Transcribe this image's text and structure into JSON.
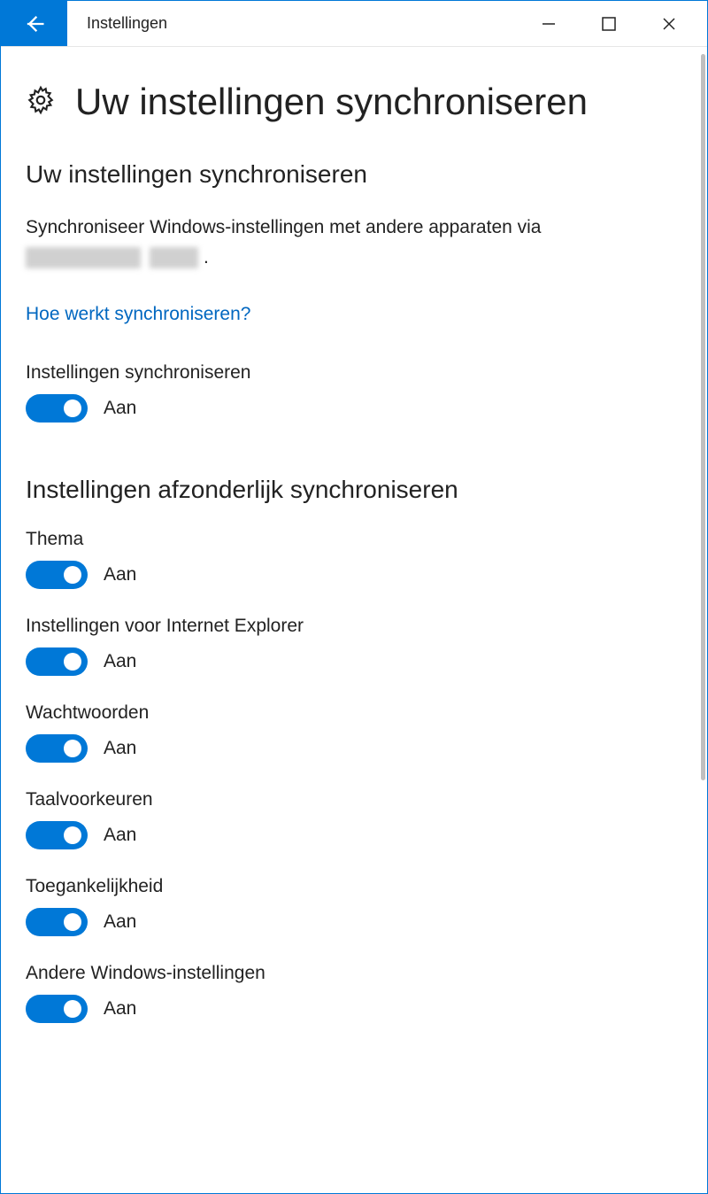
{
  "window": {
    "title": "Instellingen"
  },
  "page": {
    "title": "Uw instellingen synchroniseren"
  },
  "section1": {
    "heading": "Uw instellingen synchroniseren",
    "description": "Synchroniseer Windows-instellingen met andere apparaten via",
    "link": "Hoe werkt synchroniseren?",
    "master_toggle": {
      "label": "Instellingen synchroniseren",
      "state": "Aan"
    }
  },
  "section2": {
    "heading": "Instellingen afzonderlijk synchroniseren",
    "items": [
      {
        "label": "Thema",
        "state": "Aan"
      },
      {
        "label": "Instellingen voor Internet Explorer",
        "state": "Aan"
      },
      {
        "label": "Wachtwoorden",
        "state": "Aan"
      },
      {
        "label": "Taalvoorkeuren",
        "state": "Aan"
      },
      {
        "label": "Toegankelijkheid",
        "state": "Aan"
      },
      {
        "label": "Andere Windows-instellingen",
        "state": "Aan"
      }
    ]
  }
}
